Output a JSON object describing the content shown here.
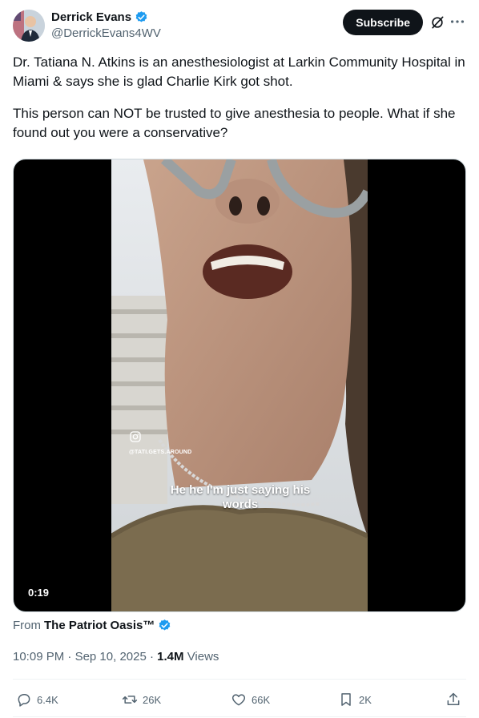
{
  "author": {
    "name": "Derrick Evans",
    "handle": "@DerrickEvans4WV"
  },
  "header": {
    "subscribe_label": "Subscribe"
  },
  "tweet": {
    "paragraph_1": "Dr. Tatiana N. Atkins is an anesthesiologist at Larkin Community Hospital in Miami & says she is glad Charlie Kirk got shot.",
    "paragraph_2": "This person can NOT be trusted to give anesthesia to people. What if she found out you were a conservative?"
  },
  "media": {
    "caption": "He he I'm just saying his words",
    "watermark": "@TATI.GETS.AROUND",
    "duration": "0:19"
  },
  "source": {
    "prefix": "From",
    "name": "The Patriot Oasis™"
  },
  "meta": {
    "time": "10:09 PM",
    "date": "Sep 10, 2025",
    "views_count": "1.4M",
    "views_label": "Views"
  },
  "actions": {
    "replies": "6.4K",
    "reposts": "26K",
    "likes": "66K",
    "bookmarks": "2K"
  },
  "colors": {
    "verified": "#1d9bf0",
    "text_secondary": "#536471",
    "subscribe_bg": "#0f1419"
  },
  "icons": [
    "verified-badge-icon",
    "grok-icon",
    "more-icon",
    "instagram-icon",
    "reply-icon",
    "repost-icon",
    "like-icon",
    "bookmark-icon",
    "share-icon"
  ]
}
